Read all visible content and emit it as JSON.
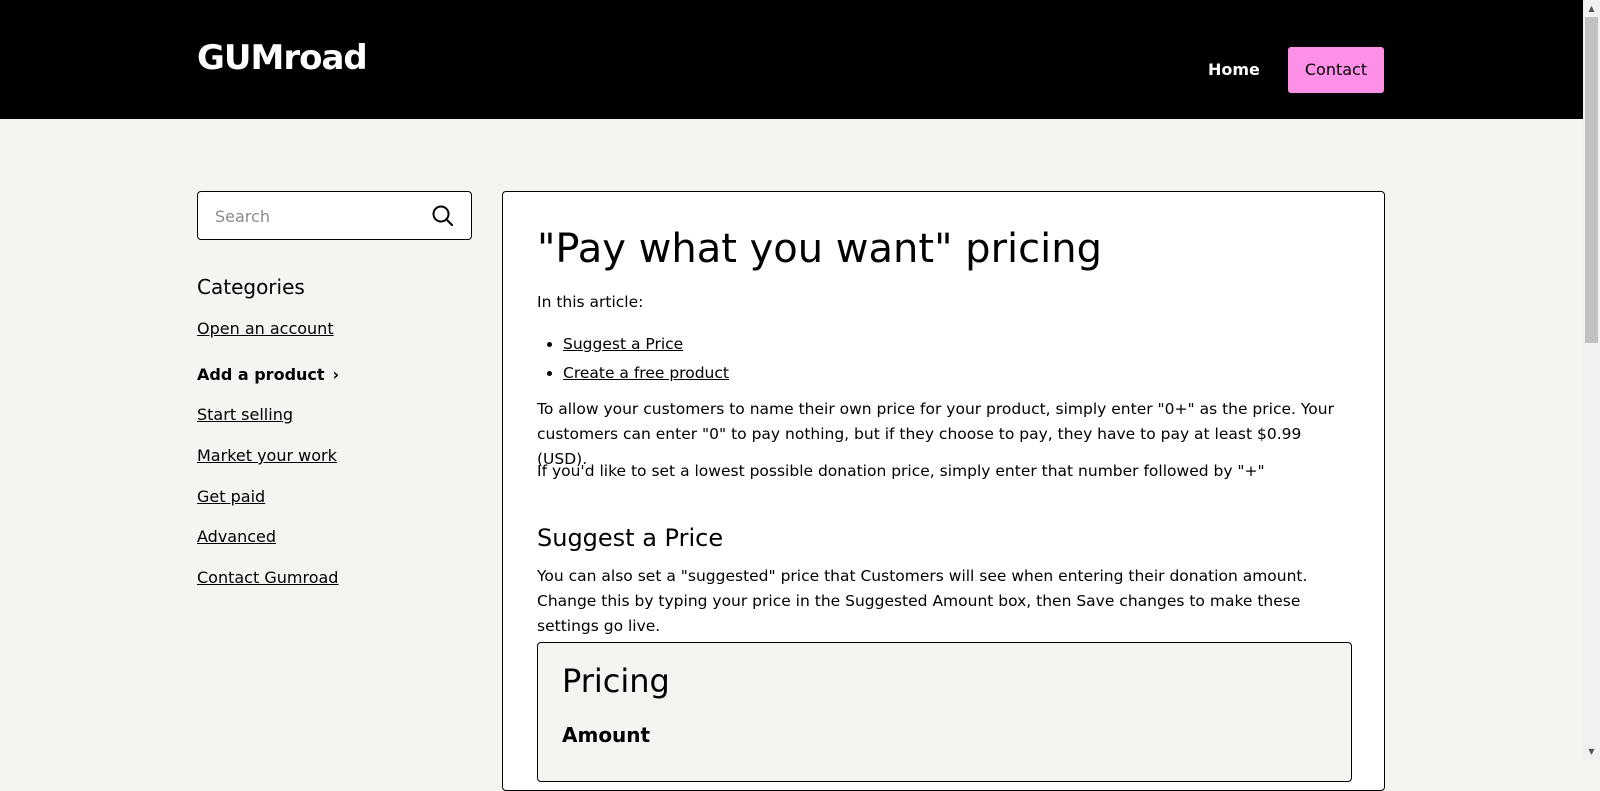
{
  "header": {
    "logo": "GUMroad",
    "nav": {
      "home": "Home",
      "contact": "Contact"
    },
    "colors": {
      "background": "#000000",
      "contact_button": "#ff90e8"
    }
  },
  "sidebar": {
    "search": {
      "placeholder": "Search",
      "value": "",
      "icon": "search-icon"
    },
    "categories_title": "Categories",
    "categories": [
      {
        "label": "Open an account",
        "current": false
      },
      {
        "label": "Add a product",
        "current": true,
        "icon": "chevron-right-icon"
      },
      {
        "label": "Start selling",
        "current": false
      },
      {
        "label": "Market your work",
        "current": false
      },
      {
        "label": "Get paid",
        "current": false
      },
      {
        "label": "Advanced",
        "current": false
      },
      {
        "label": "Contact Gumroad",
        "current": false
      }
    ]
  },
  "article": {
    "title": "\"Pay what you want\" pricing",
    "intro": "In this article:",
    "toc": [
      "Suggest a Price",
      "Create a free product"
    ],
    "paragraph1": "To allow your customers to name their own price for your product, simply enter \"0+\" as the price. Your customers can enter \"0\" to pay nothing, but if they choose to pay, they have to pay at least $0.99 (USD).",
    "paragraph2": "If you'd like to set a lowest possible donation price, simply enter that number followed by \"+\"",
    "section_heading": "Suggest a Price",
    "paragraph3": "You can also set a \"suggested\" price that Customers will see when entering their donation amount. Change this by typing your price in the Suggested Amount box, then Save changes to make these settings go live.",
    "example_box": {
      "title": "Pricing",
      "subtitle": "Amount"
    }
  }
}
